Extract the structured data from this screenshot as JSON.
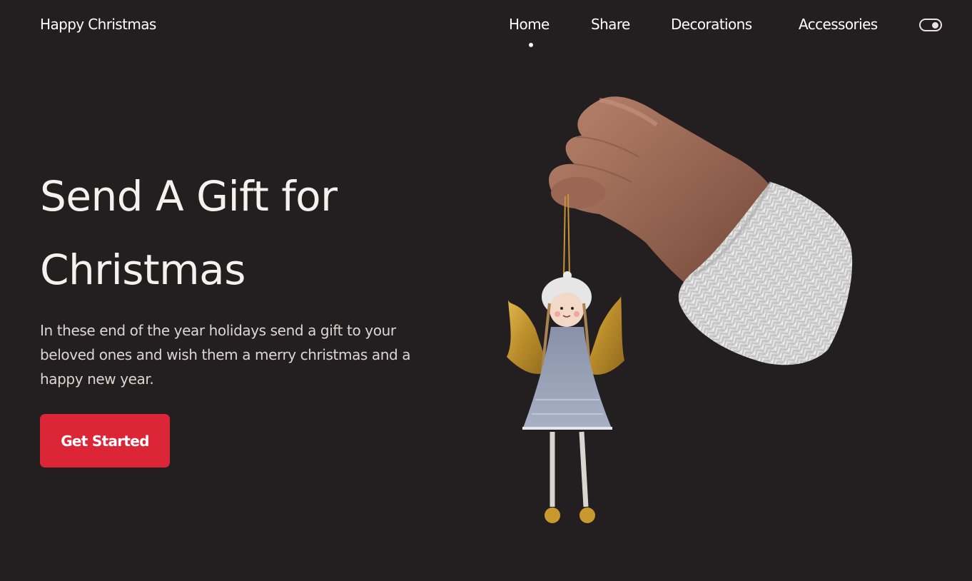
{
  "header": {
    "brand": "Happy Christmas",
    "nav": [
      {
        "label": "Home",
        "active": true
      },
      {
        "label": "Share"
      },
      {
        "label": "Decorations"
      },
      {
        "label": "Accessories"
      }
    ],
    "theme_toggle_icon": "toggle-switch-icon"
  },
  "hero": {
    "title_line1": "Send A Gift for",
    "title_line2": "Christmas",
    "description": "In these end of the year holidays send a gift to your beloved ones and wish them a merry christmas and a happy new year.",
    "cta_label": "Get Started",
    "image_alt": "hand-holding-angel-ornament"
  },
  "colors": {
    "background": "#231e1f",
    "accent": "#dc2537",
    "text": "#ffffff"
  }
}
